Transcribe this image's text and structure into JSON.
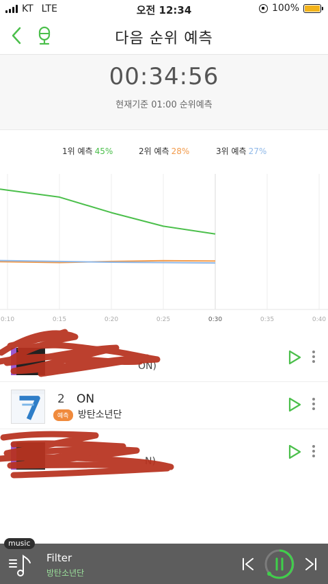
{
  "status": {
    "carrier": "KT",
    "network": "LTE",
    "time": "오전 12:34",
    "battery": "100%"
  },
  "header": {
    "title": "다음 순위 예측"
  },
  "countdown": {
    "value": "00:34:56",
    "subtitle": "현재기준 01:00 순위예측"
  },
  "legend": {
    "first_label": "1위 예측",
    "first_pct": "45%",
    "second_label": "2위 예측",
    "second_pct": "28%",
    "third_label": "3위 예측",
    "third_pct": "27%"
  },
  "chart_data": {
    "type": "line",
    "x": [
      "0:10",
      "0:15",
      "0:20",
      "0:25",
      "0:30",
      "0:35",
      "0:40"
    ],
    "series": [
      {
        "name": "1위 예측",
        "values": [
          45.8,
          44.0,
          40.0,
          36.5,
          34.5
        ],
        "color": "#4bbf4b"
      },
      {
        "name": "2위 예측",
        "values": [
          27.3,
          27.1,
          27.4,
          27.6,
          27.5
        ],
        "color": "#f29a4a"
      },
      {
        "name": "3위 예측",
        "values": [
          27.6,
          27.4,
          27.2,
          27.1,
          27.0
        ],
        "color": "#8fb8e8"
      }
    ],
    "ylim": [
      15,
      50
    ],
    "grid": true,
    "highlight_x": "0:30"
  },
  "songs": [
    {
      "partial_text": "ON)"
    },
    {
      "rank": "2",
      "title": "ON",
      "badge": "예측",
      "artist": "방탄소년단"
    },
    {
      "partial_text": "N)"
    }
  ],
  "player": {
    "tag": "music",
    "title": "Filter",
    "artist": "방탄소년단"
  },
  "colors": {
    "accent": "#4bbf4b",
    "badge": "#f08a3c",
    "player_bg": "#5d5d5d"
  }
}
